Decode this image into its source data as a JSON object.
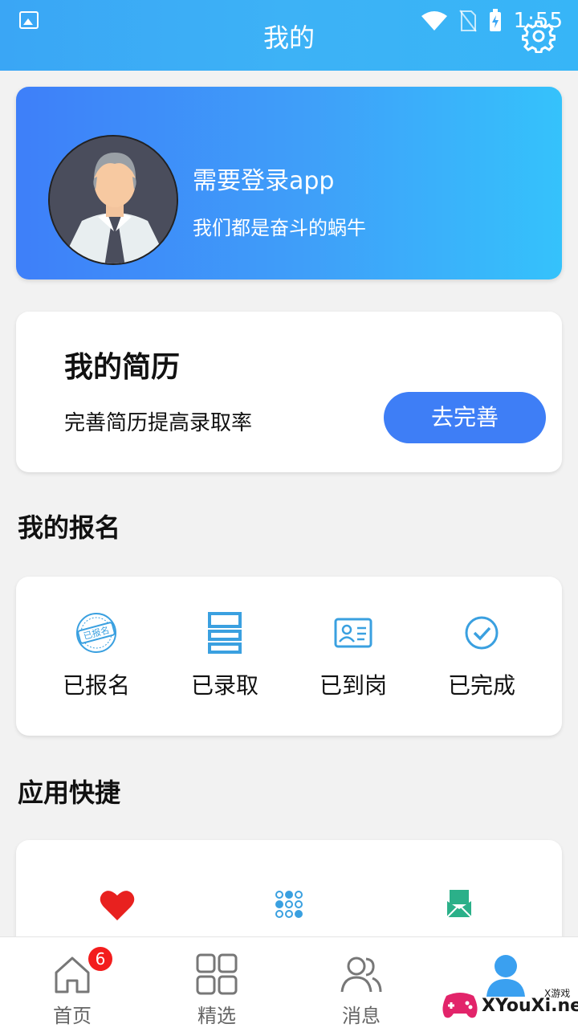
{
  "status_bar": {
    "time": "1:55"
  },
  "header": {
    "title": "我的"
  },
  "profile": {
    "name": "需要登录app",
    "subtitle": "我们都是奋斗的蜗牛"
  },
  "resume": {
    "title": "我的简历",
    "subtitle": "完善简历提高录取率",
    "button": "去完善"
  },
  "signup": {
    "section_title": "我的报名",
    "items": [
      {
        "label": "已报名",
        "icon": "stamp-icon"
      },
      {
        "label": "已录取",
        "icon": "layout-icon"
      },
      {
        "label": "已到岗",
        "icon": "id-card-icon"
      },
      {
        "label": "已完成",
        "icon": "check-circle-icon"
      }
    ]
  },
  "quick": {
    "section_title": "应用快捷",
    "items": [
      {
        "label": "",
        "icon": "heart-icon"
      },
      {
        "label": "",
        "icon": "dial-pad-icon"
      },
      {
        "label": "",
        "icon": "mail-icon"
      }
    ]
  },
  "bottom_nav": {
    "items": [
      {
        "label": "首页",
        "icon": "home-icon",
        "badge": "6"
      },
      {
        "label": "精选",
        "icon": "grid-icon"
      },
      {
        "label": "消息",
        "icon": "users-icon"
      },
      {
        "label": "",
        "icon": "profile-icon"
      }
    ]
  },
  "watermark": {
    "text": "XYouXi.net",
    "small": "X游戏"
  },
  "colors": {
    "primary": "#3e7ef6",
    "header": "#3aa6f5",
    "badge": "#f31d1d",
    "icon": "#3aa0e0",
    "heart": "#e8211f",
    "mail": "#2bb089"
  }
}
